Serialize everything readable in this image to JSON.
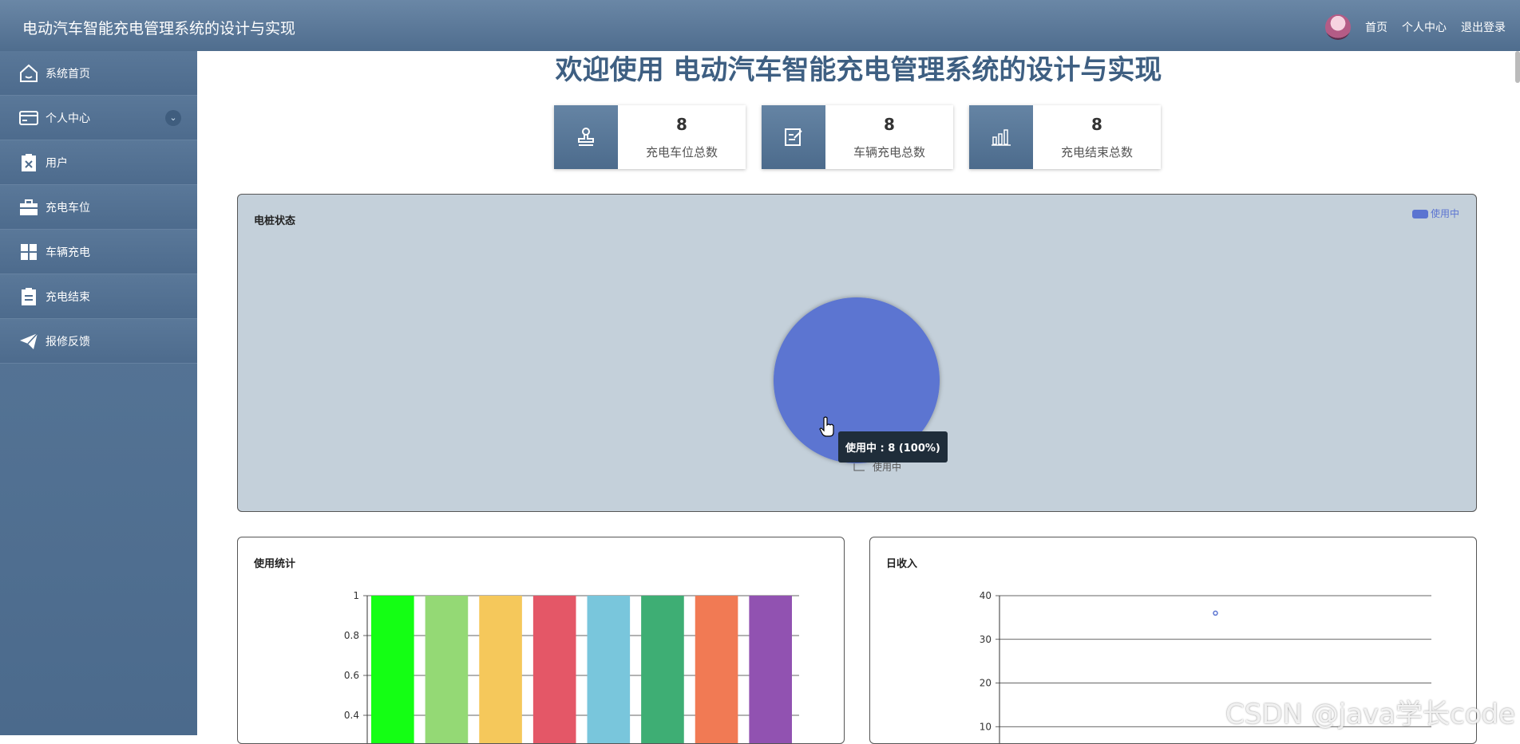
{
  "header": {
    "title": "电动汽车智能充电管理系统的设计与实现",
    "nav": [
      "首页",
      "个人中心",
      "退出登录"
    ]
  },
  "sidebar": {
    "items": [
      {
        "label": "系统首页",
        "icon": "home-icon"
      },
      {
        "label": "个人中心",
        "icon": "card-icon",
        "expandable": true
      },
      {
        "label": "用户",
        "icon": "clipboard-x-icon"
      },
      {
        "label": "充电车位",
        "icon": "briefcase-icon"
      },
      {
        "label": "车辆充电",
        "icon": "grid-icon"
      },
      {
        "label": "充电结束",
        "icon": "document-icon"
      },
      {
        "label": "报修反馈",
        "icon": "paper-plane-icon"
      }
    ]
  },
  "main": {
    "welcome": "欢迎使用 电动汽车智能充电管理系统的设计与实现",
    "stats": [
      {
        "value": "8",
        "label": "充电车位总数",
        "icon": "stamp-icon"
      },
      {
        "value": "8",
        "label": "车辆充电总数",
        "icon": "edit-note-icon"
      },
      {
        "value": "8",
        "label": "充电结束总数",
        "icon": "bar-chart-icon"
      }
    ]
  },
  "chart_data": [
    {
      "type": "pie",
      "title": "电桩状态",
      "legend": [
        "使用中"
      ],
      "legend_position": "top-right",
      "slices": [
        {
          "name": "使用中",
          "value": 8,
          "color": "#5b74d1"
        }
      ],
      "tooltip": "使用中 : 8 (100%)",
      "slice_label": "使用中",
      "background": "#c4d0da"
    },
    {
      "type": "bar",
      "title": "使用统计",
      "categories": [
        "",
        "",
        "",
        "",
        "",
        "",
        "",
        ""
      ],
      "values": [
        1,
        1,
        1,
        1,
        1,
        1,
        1,
        1
      ],
      "colors": [
        "#14ff14",
        "#94d975",
        "#f5c85b",
        "#e45767",
        "#79c6dc",
        "#3eae74",
        "#f17a54",
        "#9152b1"
      ],
      "ylim": [
        0,
        1
      ],
      "yticks": [
        "1",
        "0.8",
        "0.6",
        "0.4"
      ],
      "grid": true
    },
    {
      "type": "scatter",
      "title": "日收入",
      "points": [
        {
          "x": 0.5,
          "y": 36
        }
      ],
      "ylim": [
        0,
        40
      ],
      "yticks": [
        "40",
        "30",
        "20",
        "10"
      ],
      "grid": true,
      "color": "#5b74d1"
    }
  ],
  "watermark": "CSDN @java学长code"
}
